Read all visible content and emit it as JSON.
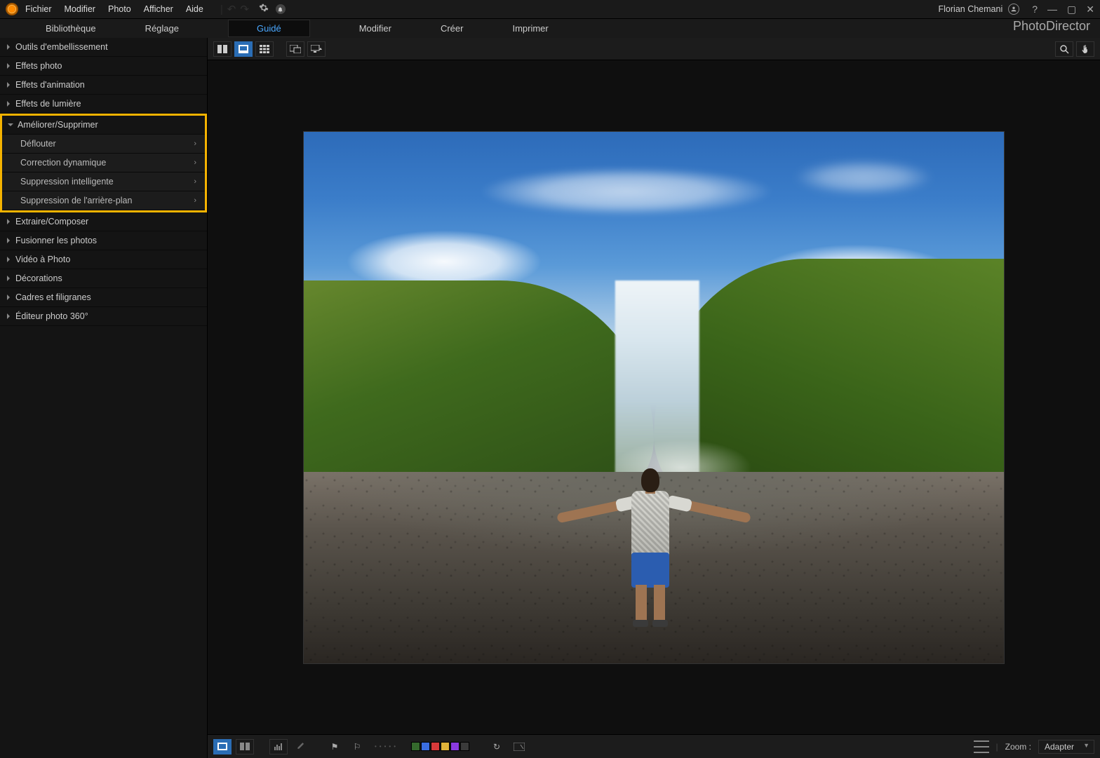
{
  "menu": {
    "items": [
      "Fichier",
      "Modifier",
      "Photo",
      "Afficher",
      "Aide"
    ]
  },
  "user": {
    "name": "Florian Chemani"
  },
  "brand": "PhotoDirector",
  "tabs": {
    "items": [
      "Bibliothèque",
      "Réglage",
      "Guidé",
      "Modifier",
      "Créer",
      "Imprimer"
    ],
    "activeIndex": 2
  },
  "sidebar": {
    "panels": [
      {
        "label": "Outils d'embellissement",
        "expanded": false
      },
      {
        "label": "Effets photo",
        "expanded": false
      },
      {
        "label": "Effets d'animation",
        "expanded": false
      },
      {
        "label": "Effets de lumière",
        "expanded": false
      },
      {
        "label": "Améliorer/Supprimer",
        "expanded": true,
        "highlighted": true,
        "children": [
          {
            "label": "Déflouter"
          },
          {
            "label": "Correction dynamique"
          },
          {
            "label": "Suppression intelligente"
          },
          {
            "label": "Suppression de l'arrière-plan"
          }
        ]
      },
      {
        "label": "Extraire/Composer",
        "expanded": false
      },
      {
        "label": "Fusionner les photos",
        "expanded": false
      },
      {
        "label": "Vidéo à Photo",
        "expanded": false
      },
      {
        "label": "Décorations",
        "expanded": false
      },
      {
        "label": "Cadres et filigranes",
        "expanded": false
      },
      {
        "label": "Éditeur photo 360°",
        "expanded": false
      }
    ]
  },
  "bottombar": {
    "zoomLabel": "Zoom :",
    "zoomValue": "Adapter",
    "swatches": [
      "#356a2d",
      "#3a6de0",
      "#d63a3a",
      "#e0b43a",
      "#8a3ae0",
      "#3a3a3a"
    ]
  }
}
